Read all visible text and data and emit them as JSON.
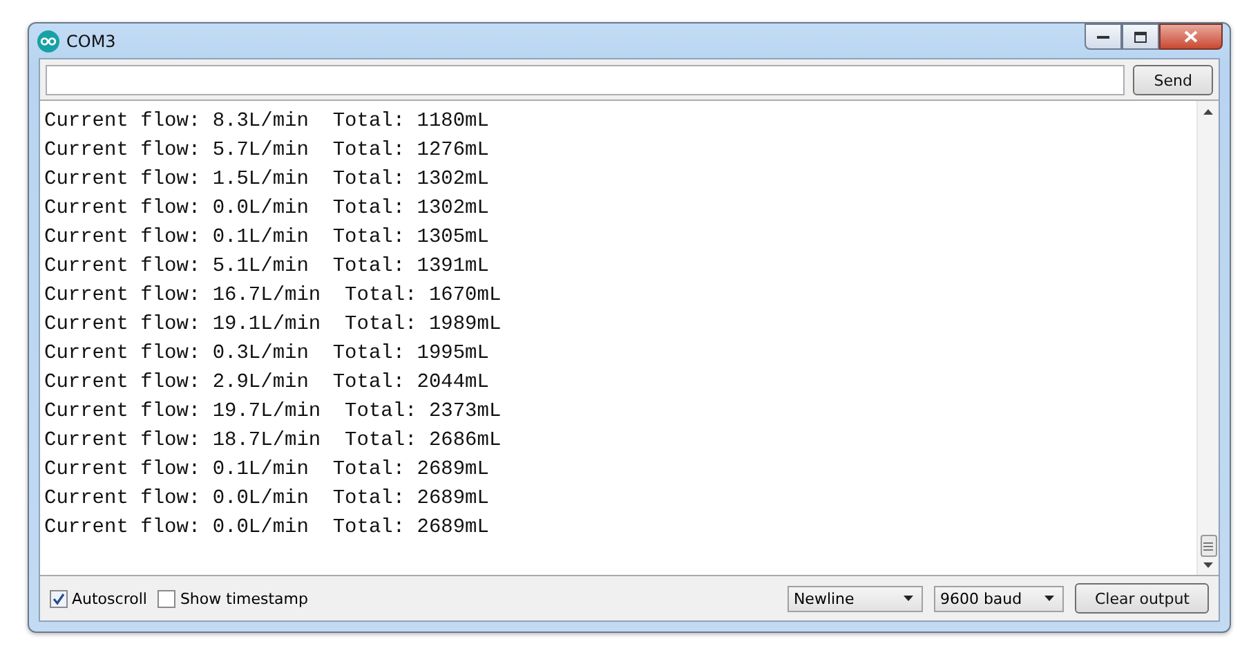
{
  "window": {
    "title": "COM3"
  },
  "send_button": "Send",
  "output_lines": [
    "Current flow: 8.3L/min  Total: 1180mL",
    "Current flow: 5.7L/min  Total: 1276mL",
    "Current flow: 1.5L/min  Total: 1302mL",
    "Current flow: 0.0L/min  Total: 1302mL",
    "Current flow: 0.1L/min  Total: 1305mL",
    "Current flow: 5.1L/min  Total: 1391mL",
    "Current flow: 16.7L/min  Total: 1670mL",
    "Current flow: 19.1L/min  Total: 1989mL",
    "Current flow: 0.3L/min  Total: 1995mL",
    "Current flow: 2.9L/min  Total: 2044mL",
    "Current flow: 19.7L/min  Total: 2373mL",
    "Current flow: 18.7L/min  Total: 2686mL",
    "Current flow: 0.1L/min  Total: 2689mL",
    "Current flow: 0.0L/min  Total: 2689mL",
    "Current flow: 0.0L/min  Total: 2689mL"
  ],
  "options": [
    {
      "label": "Autoscroll",
      "checked": true
    },
    {
      "label": "Show timestamp",
      "checked": false
    }
  ],
  "line_ending": {
    "value": "Newline"
  },
  "baud_rate": {
    "value": "9600 baud"
  },
  "clear_button": "Clear output"
}
